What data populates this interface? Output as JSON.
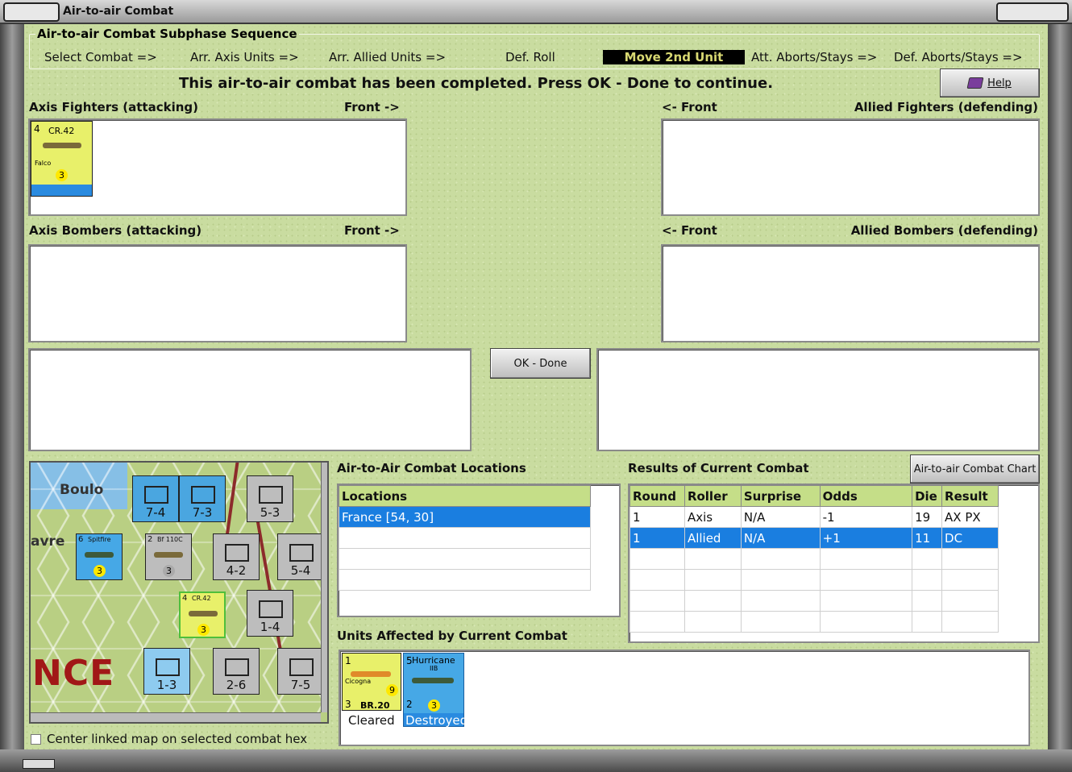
{
  "window": {
    "title": "Air-to-air Combat"
  },
  "sequence": {
    "title": "Air-to-air Combat Subphase Sequence",
    "steps": [
      "Select Combat =>",
      "Arr. Axis Units =>",
      "Arr. Allied Units =>",
      "Def. Roll",
      "Move 2nd Unit",
      "Att. Aborts/Stays =>",
      "Def. Aborts/Stays =>"
    ],
    "active_step": "Move 2nd Unit"
  },
  "status_message": "This air-to-air combat has been completed.  Press OK - Done to continue.",
  "help_button": "Help",
  "panels": {
    "axis_fighters": {
      "label": "Axis Fighters (attacking)",
      "front": "Front ->"
    },
    "allied_fighters": {
      "label": "Allied Fighters (defending)",
      "front": "<- Front"
    },
    "axis_bombers": {
      "label": "Axis Bombers (attacking)",
      "front": "Front ->"
    },
    "allied_bombers": {
      "label": "Allied Bombers (defending)",
      "front": "<- Front"
    }
  },
  "axis_fighter_counter": {
    "strength": "4",
    "name": "CR.42",
    "subname": "Falco",
    "coin": "3"
  },
  "ok_button": "OK - Done",
  "locations": {
    "title": "Air-to-Air Combat Locations",
    "header": "Locations",
    "rows": [
      "France [54, 30]"
    ]
  },
  "results": {
    "title": "Results of Current Combat",
    "chart_button": "Air-to-air Combat Chart",
    "headers": [
      "Round",
      "Roller",
      "Surprise",
      "Odds",
      "Die",
      "Result"
    ],
    "rows": [
      [
        "1",
        "Axis",
        "N/A",
        "-1",
        "19",
        "AX PX"
      ],
      [
        "1",
        "Allied",
        "N/A",
        "+1",
        "11",
        "DC"
      ]
    ],
    "selected_row": 1
  },
  "units_affected": {
    "title": "Units Affected by Current Combat",
    "units": [
      {
        "name": "BR.20",
        "subname": "Cicogna",
        "top": "1",
        "bottom": "3",
        "coin": "9",
        "status": "Cleared"
      },
      {
        "name": "Hurricane",
        "subname": "IIB",
        "top": "5",
        "bottom": "2",
        "left": "3",
        "coin": "3",
        "status": "Destroyed"
      }
    ]
  },
  "map": {
    "city_labels": [
      "Boulo",
      "avre"
    ],
    "country_label": "NCE",
    "units": [
      {
        "value": "7-4",
        "color": "#4aa6e0"
      },
      {
        "value": "7-3",
        "color": "#4aa6e0"
      },
      {
        "value": "5-3",
        "color": "#bdbdbd"
      },
      {
        "value": "4-2",
        "color": "#bdbdbd"
      },
      {
        "value": "5-4",
        "color": "#bdbdbd"
      },
      {
        "value": "1-4",
        "color": "#bdbdbd"
      },
      {
        "value": "1-3",
        "color": "#8ecbef"
      },
      {
        "value": "2-6",
        "color": "#bdbdbd"
      },
      {
        "value": "7-5",
        "color": "#bdbdbd"
      }
    ],
    "air_units": [
      {
        "name": "Spitfire",
        "top": "6",
        "coin": "3"
      },
      {
        "name": "Bf 110C",
        "top": "2",
        "coin": "3"
      },
      {
        "name": "CR.42",
        "top": "4",
        "coin": "3"
      }
    ]
  },
  "center_map_checkbox": "Center linked map on selected combat hex"
}
